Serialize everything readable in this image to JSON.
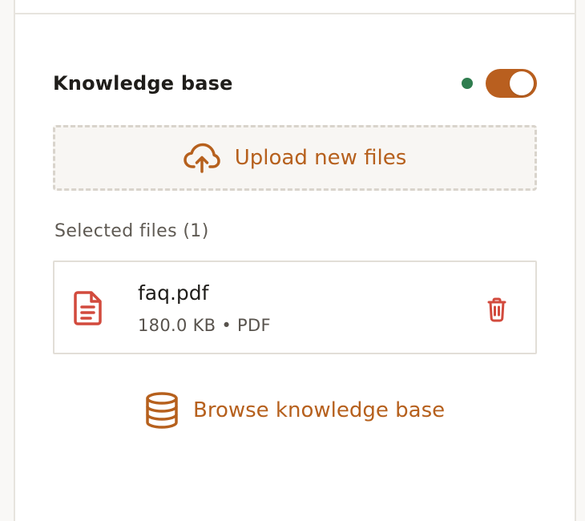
{
  "knowledge_base": {
    "title": "Knowledge base",
    "enabled": true,
    "status_color": "#2f7d4f",
    "toggle_color": "#b95f1f"
  },
  "upload": {
    "label": "Upload new files",
    "icon": "cloud-upload-icon"
  },
  "selected_files": {
    "label": "Selected files (1)",
    "items": [
      {
        "name": "faq.pdf",
        "meta": "180.0 KB • PDF",
        "icon": "document-icon",
        "icon_color": "#d24a3d",
        "delete_icon": "trash-icon"
      }
    ]
  },
  "browse": {
    "label": "Browse knowledge base",
    "icon": "database-icon",
    "color": "#b6601d"
  }
}
